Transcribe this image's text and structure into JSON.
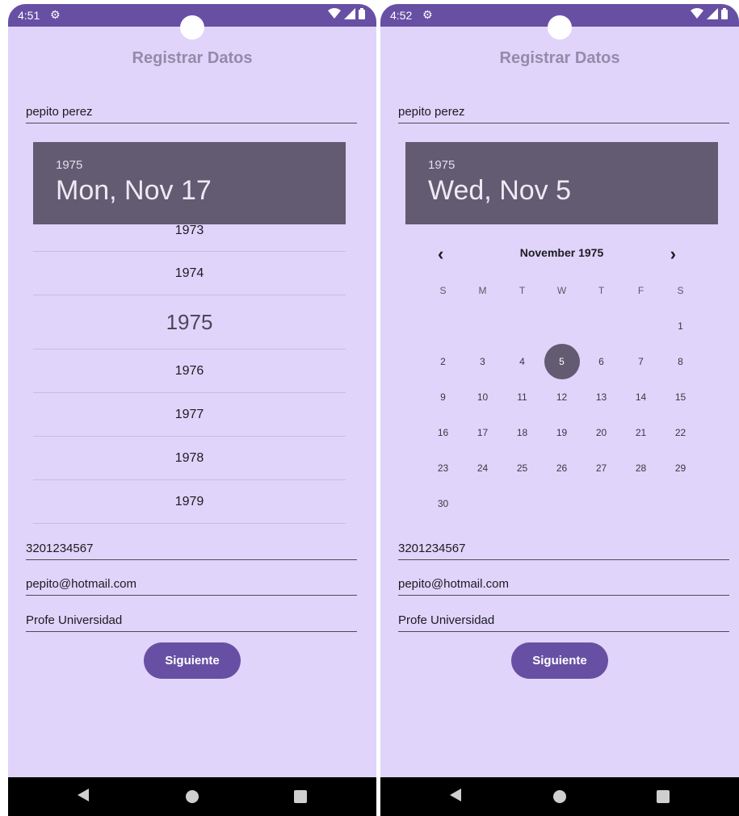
{
  "left": {
    "status": {
      "time": "4:51"
    },
    "title": "Registrar Datos",
    "name_value": "pepito perez",
    "picker": {
      "year": "1975",
      "date": "Mon, Nov 17",
      "years": [
        "1973",
        "1974",
        "1975",
        "1976",
        "1977",
        "1978",
        "1979"
      ],
      "selected_year": "1975"
    },
    "phone_value": "3201234567",
    "email_value": "pepito@hotmail.com",
    "occupation_value": "Profe Universidad",
    "next_label": "Siguiente"
  },
  "right": {
    "status": {
      "time": "4:52"
    },
    "title": "Registrar Datos",
    "name_value": "pepito perez",
    "picker": {
      "year": "1975",
      "date": "Wed, Nov 5",
      "month_label": "November 1975",
      "weekdays": [
        "S",
        "M",
        "T",
        "W",
        "T",
        "F",
        "S"
      ],
      "weeks": [
        [
          "",
          "",
          "",
          "",
          "",
          "",
          "1"
        ],
        [
          "2",
          "3",
          "4",
          "5",
          "6",
          "7",
          "8"
        ],
        [
          "9",
          "10",
          "11",
          "12",
          "13",
          "14",
          "15"
        ],
        [
          "16",
          "17",
          "18",
          "19",
          "20",
          "21",
          "22"
        ],
        [
          "23",
          "24",
          "25",
          "26",
          "27",
          "28",
          "29"
        ],
        [
          "30",
          "",
          "",
          "",
          "",
          "",
          ""
        ]
      ],
      "selected_day": "5"
    },
    "phone_value": "3201234567",
    "email_value": "pepito@hotmail.com",
    "occupation_value": "Profe Universidad",
    "next_label": "Siguiente"
  },
  "icons": {
    "status_gear": "gear-icon",
    "status_wifi": "wifi-icon",
    "status_signal": "signal-icon",
    "status_battery": "battery-icon",
    "nav_back": "back-icon",
    "nav_home": "home-icon",
    "nav_recent": "recent-apps-icon",
    "prev": "chevron-left-icon",
    "next": "chevron-right-icon"
  },
  "colors": {
    "primary": "#6750a4",
    "background": "#e0d4fb",
    "picker_header": "#625b71"
  }
}
